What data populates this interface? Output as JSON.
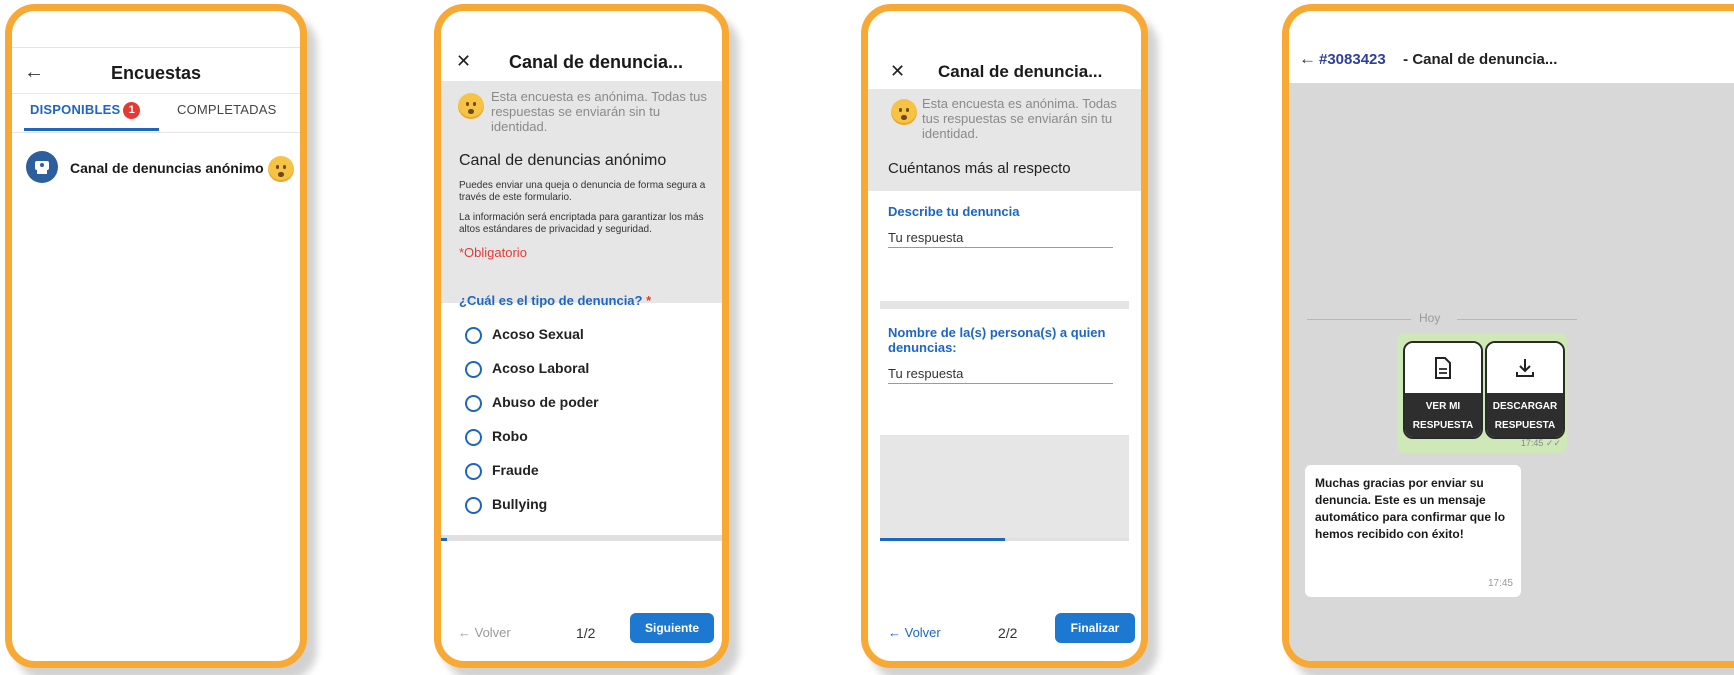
{
  "screen1": {
    "title": "Encuestas",
    "back_icon": "arrow-left",
    "tabs": [
      {
        "label": "DISPONIBLES",
        "badge": "1"
      },
      {
        "label": "COMPLETADAS"
      }
    ],
    "survey_item": {
      "name": "Canal de denuncias anónimo",
      "emoji": "shushing-face"
    }
  },
  "screen2": {
    "title": "Canal de denuncia...",
    "anon_notice": "Esta encuesta es anónima. Todas tus respuestas se enviarán sin tu identidad.",
    "form_name": "Canal de denuncias anónimo",
    "description1": "Puedes enviar una queja o denuncia de forma segura a través de este formulario.",
    "description2": "La información será encriptada para garantizar los más altos estándares de privacidad y seguridad.",
    "required_note": "*Obligatorio",
    "question": "¿Cuál es el tipo de denuncia?",
    "required_mark": "*",
    "options": [
      "Acoso Sexual",
      "Acoso Laboral",
      "Abuso de poder",
      "Robo",
      "Fraude",
      "Bullying"
    ],
    "back_label": "← Volver",
    "page": "1/2",
    "next_label": "Siguiente",
    "progress": 0.02
  },
  "screen3": {
    "title": "Canal de denuncia...",
    "anon_notice": "Esta encuesta es anónima. Todas tus respuestas se enviarán sin tu identidad.",
    "section_title": "Cuéntanos más al respecto",
    "q1": "Describe tu denuncia",
    "q1_placeholder": "Tu respuesta",
    "q2": "Nombre de la(s) persona(s) a quien denuncias:",
    "q2_placeholder": "Tu respuesta",
    "back_label": "← Volver",
    "page": "2/2",
    "finish_label": "Finalizar",
    "progress": 0.5
  },
  "screen4": {
    "chat_id": "#3083423",
    "title_sep": " - ",
    "title": "Canal de denuncia...",
    "day_divider": "Hoy",
    "card1": {
      "label_line1": "VER MI",
      "label_line2": "RESPUESTA",
      "icon": "document-icon"
    },
    "card2": {
      "label_line1": "DESCARGAR",
      "label_line2": "RESPUESTA",
      "icon": "download-icon"
    },
    "sent_time": "17:45",
    "reply_text": "Muchas gracias por enviar su denuncia. Este es un mensaje automático para confirmar que lo hemos recibido con éxito!",
    "reply_time": "17:45"
  },
  "colors": {
    "frame": "#f7a934",
    "accent_blue": "#1d66c2",
    "button_blue": "#1d78d1",
    "required_red": "#e53935",
    "chat_green": "#cfe8b8",
    "chat_bg": "#d8d8d8"
  }
}
